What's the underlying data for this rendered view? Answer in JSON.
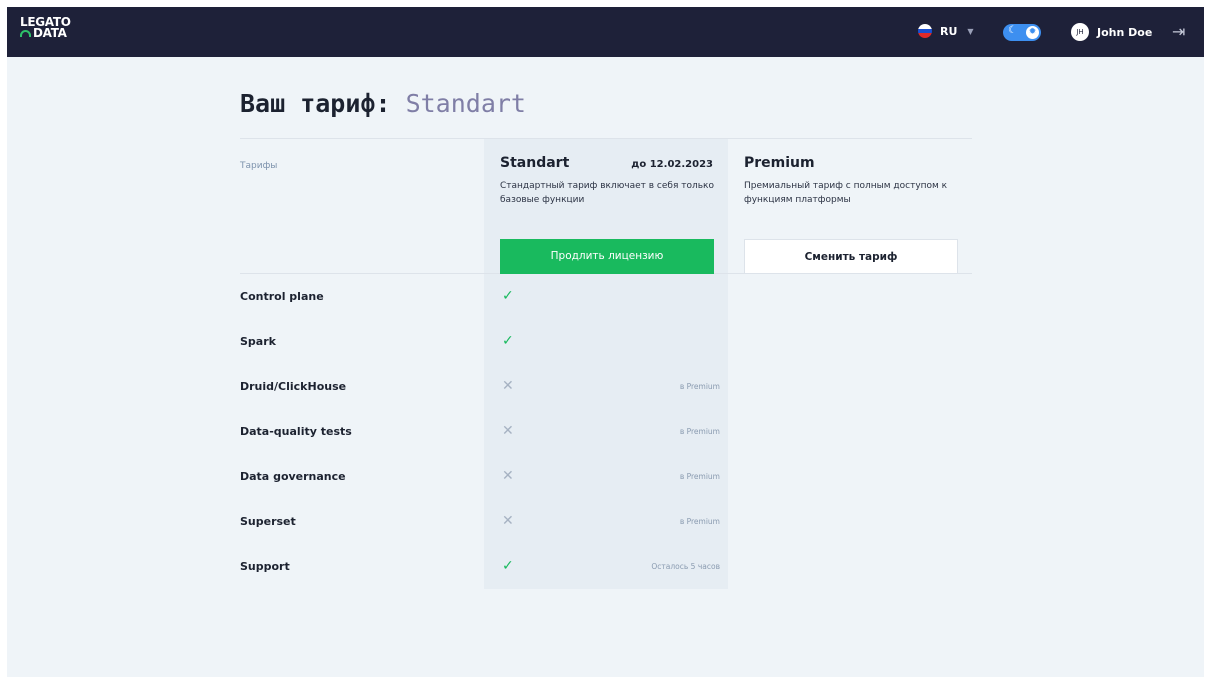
{
  "header": {
    "logo_line1": "LEGATO",
    "logo_line2": "DATA",
    "language": "RU",
    "flag_colors": [
      "#ffffff",
      "#1b4fd1",
      "#e02a2a"
    ],
    "user_initials": "JH",
    "user_name": "John Doe",
    "colors": {
      "background": "#1e2139",
      "toggle": "#3d8ff0"
    }
  },
  "page": {
    "title_prefix": "Ваш тариф:",
    "current_plan": "Standart",
    "tariffs_label": "Тарифы"
  },
  "plans": [
    {
      "name": "Standart",
      "valid_until": "до 12.02.2023",
      "description": "Стандартный тариф включает в себя только базовые функции",
      "button_label": "Продлить лицензию",
      "button_color": "#19ba5e"
    },
    {
      "name": "Premium",
      "description": "Премиальный тариф с полным доступом к функциям платформы",
      "button_label": "Сменить тариф"
    }
  ],
  "features": [
    {
      "name": "Control plane",
      "included": true,
      "mark": "✓",
      "note": ""
    },
    {
      "name": "Spark",
      "included": true,
      "mark": "✓",
      "note": ""
    },
    {
      "name": "Druid/ClickHouse",
      "included": false,
      "mark": "✕",
      "note": "в Premium"
    },
    {
      "name": "Data-quality tests",
      "included": false,
      "mark": "✕",
      "note": "в Premium"
    },
    {
      "name": "Data governance",
      "included": false,
      "mark": "✕",
      "note": "в Premium"
    },
    {
      "name": "Superset",
      "included": false,
      "mark": "✕",
      "note": "в Premium"
    },
    {
      "name": "Support",
      "included": true,
      "mark": "✓",
      "note": "Осталось 5 часов"
    }
  ]
}
